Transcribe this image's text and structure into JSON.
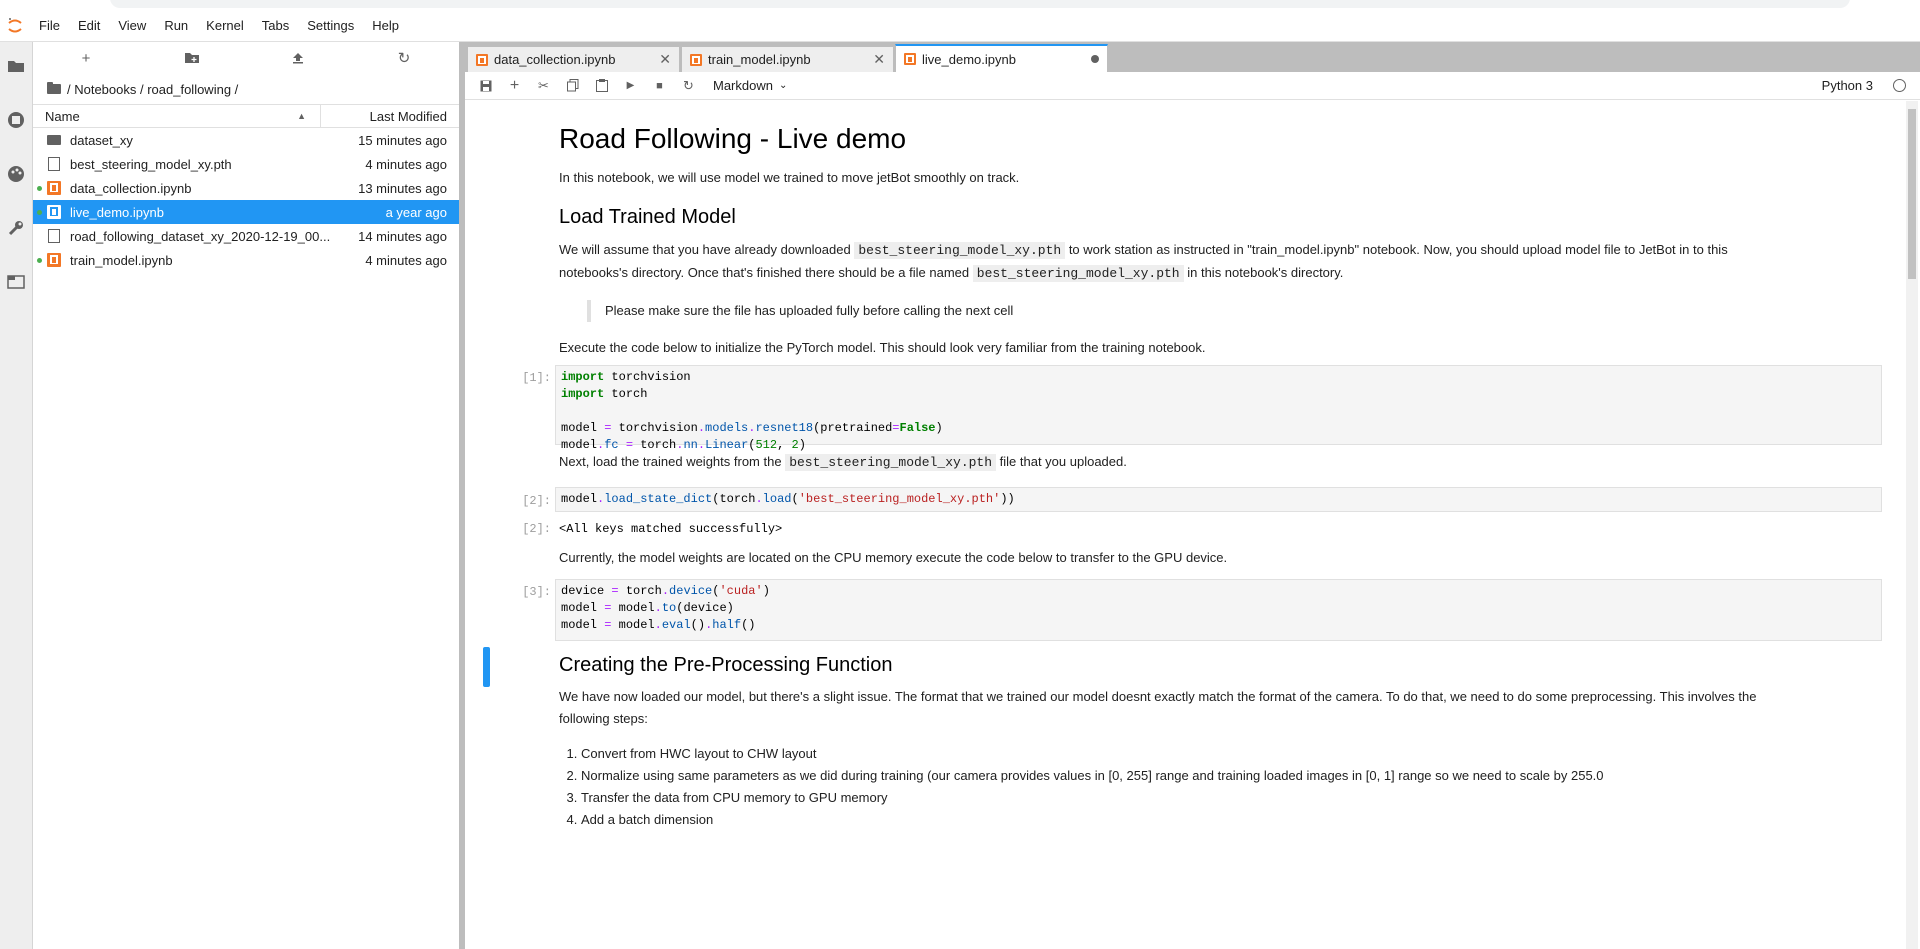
{
  "menubar": {
    "items": [
      "File",
      "Edit",
      "View",
      "Run",
      "Kernel",
      "Tabs",
      "Settings",
      "Help"
    ]
  },
  "filebrowser": {
    "breadcrumb": "/ Notebooks / road_following /",
    "col_name": "Name",
    "col_modified": "Last Modified",
    "files": [
      {
        "name": "dataset_xy",
        "modified": "15 minutes ago",
        "kind": "folder",
        "running": false,
        "selected": false
      },
      {
        "name": "best_steering_model_xy.pth",
        "modified": "4 minutes ago",
        "kind": "file",
        "running": false,
        "selected": false
      },
      {
        "name": "data_collection.ipynb",
        "modified": "13 minutes ago",
        "kind": "notebook",
        "running": true,
        "selected": false
      },
      {
        "name": "live_demo.ipynb",
        "modified": "a year ago",
        "kind": "notebook",
        "running": true,
        "selected": true
      },
      {
        "name": "road_following_dataset_xy_2020-12-19_00...",
        "modified": "14 minutes ago",
        "kind": "file",
        "running": false,
        "selected": false
      },
      {
        "name": "train_model.ipynb",
        "modified": "4 minutes ago",
        "kind": "notebook",
        "running": true,
        "selected": false
      }
    ]
  },
  "tabs": [
    {
      "label": "data_collection.ipynb",
      "active": false
    },
    {
      "label": "train_model.ipynb",
      "active": false
    },
    {
      "label": "live_demo.ipynb",
      "active": true
    }
  ],
  "toolbar": {
    "cell_type": "Markdown",
    "kernel": "Python 3"
  },
  "notebook": {
    "title": "Road Following - Live demo",
    "intro": "In this notebook, we will use model we trained to move jetBot smoothly on track.",
    "h_load": "Load Trained Model",
    "p1_a": "We will assume that you have already downloaded",
    "p1_code": "best_steering_model_xy.pth",
    "p1_b": "to work station as instructed in \"train_model.ipynb\" notebook. Now, you should upload model file to JetBot in to this",
    "p1_c": "notebooks's directory. Once that's finished there should be a file named",
    "p1_code2": "best_steering_model_xy.pth",
    "p1_d": "in this notebook's directory.",
    "quote": "Please make sure the file has uploaded fully before calling the next cell",
    "p2": "Execute the code below to initialize the PyTorch model. This should look very familiar from the training notebook.",
    "prompt1": "[1]:",
    "p3_a": "Next, load the trained weights from the",
    "p3_code": "best_steering_model_xy.pth",
    "p3_b": "file that you uploaded.",
    "prompt2": "[2]:",
    "out_prompt2": "[2]:",
    "out2": "<All keys matched successfully>",
    "p4": "Currently, the model weights are located on the CPU memory execute the code below to transfer to the GPU device.",
    "prompt3": "[3]:",
    "h_pre": "Creating the Pre-Processing Function",
    "p5_a": "We have now loaded our model, but there's a slight issue. The format that we trained our model doesnt exactly match the format of the camera. To do that, we need to do some preprocessing. This involves the",
    "p5_b": "following steps:",
    "steps": [
      "Convert from HWC layout to CHW layout",
      "Normalize using same parameters as we did during training (our camera provides values in [0, 255] range and training loaded images in [0, 1] range so we need to scale by 255.0",
      "Transfer the data from CPU memory to GPU memory",
      "Add a batch dimension"
    ]
  },
  "colors": {
    "accent": "#2196f3",
    "jupyter_orange": "#f37726",
    "running_dot": "#4caf50"
  }
}
